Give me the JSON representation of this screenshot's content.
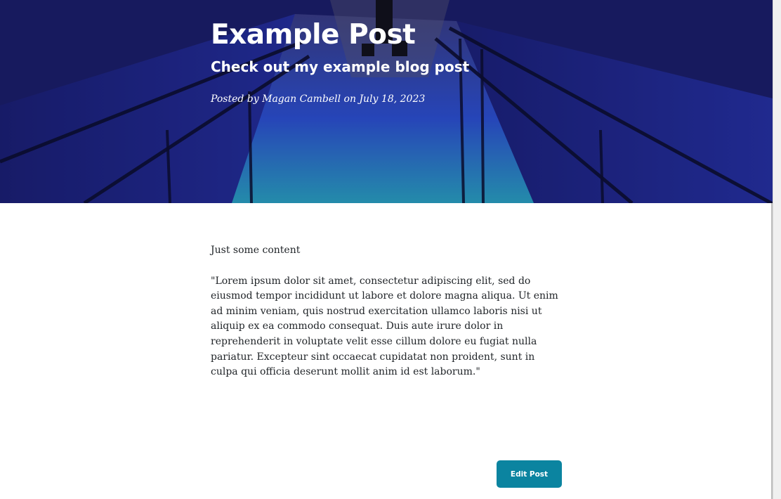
{
  "post": {
    "title": "Example Post",
    "subtitle": "Check out my example blog post",
    "meta": "Posted by Magan Cambell on July 18, 2023"
  },
  "content": {
    "paragraphs": [
      "Just some content",
      "\"Lorem ipsum dolor sit amet, consectetur adipiscing elit, sed do eiusmod tempor incididunt ut labore et dolore magna aliqua. Ut enim ad minim veniam, quis nostrud exercitation ullamco laboris nisi ut aliquip ex ea commodo consequat. Duis aute irure dolor in reprehenderit in voluptate velit esse cillum dolore eu fugiat nulla pariatur. Excepteur sint occaecat cupidatat non proident, sunt in culpa qui officia deserunt mollit anim id est laborum.\""
    ]
  },
  "actions": {
    "edit_label": "Edit Post"
  },
  "colors": {
    "button": "#0b84a0",
    "hero": "#1d2a9c"
  }
}
